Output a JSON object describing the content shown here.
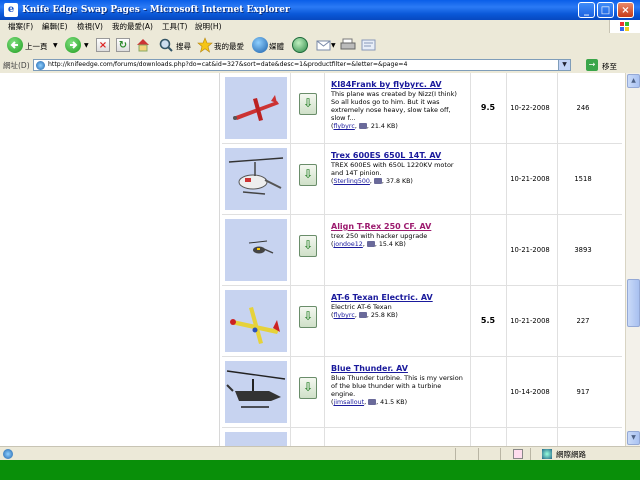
{
  "window": {
    "title": "Knife Edge Swap Pages - Microsoft Internet Explorer"
  },
  "menu": [
    "檔案(F)",
    "編輯(E)",
    "檢視(V)",
    "我的最愛(A)",
    "工具(T)",
    "說明(H)"
  ],
  "toolbar": {
    "back_label": "上一頁",
    "search_label": "搜尋",
    "favorites_label": "我的最愛",
    "media_label": "媒體"
  },
  "address": {
    "label": "網址(D)",
    "url": "http://knifeedge.com/forums/downloads.php?do=cat&id=327&sort=date&desc=1&productfilter=&letter=&page=4",
    "go_label": "移至"
  },
  "rows": [
    {
      "title": "KI84Frank by flybyrc.  AV",
      "desc": "This plane was created by Nizz(I think) So all kudos go to him. But it was extremely nose heavy, slow take off, slow f...",
      "user": "flybyrc",
      "size": "21.4 KB",
      "rating": "9.5",
      "date": "10-22-2008",
      "views": "246",
      "visited": false
    },
    {
      "title": "Trex 600ES 650L 14T.  AV",
      "desc": "TREX 600ES with 650L 1220KV motor and 14T pinion.",
      "user": "Sterling500",
      "size": "37.8 KB",
      "rating": "",
      "date": "10-21-2008",
      "views": "1518",
      "visited": false
    },
    {
      "title": "Align T-Rex 250 CF.  AV",
      "desc": "trex 250 with hacker upgrade",
      "user": "jondoe12",
      "size": "15.4 KB",
      "rating": "",
      "date": "10-21-2008",
      "views": "3893",
      "visited": true
    },
    {
      "title": "AT-6 Texan Electric.  AV",
      "desc": "Electric AT-6 Texan",
      "user": "flybyrc",
      "size": "25.8 KB",
      "rating": "5.5",
      "date": "10-21-2008",
      "views": "227",
      "visited": false
    },
    {
      "title": "Blue Thunder.  AV",
      "desc": "Blue Thunder turbine. This is my version of the blue thunder with a turbine engine.",
      "user": "jimsallout",
      "size": "41.5 KB",
      "rating": "",
      "date": "10-14-2008",
      "views": "917",
      "visited": false
    },
    {
      "title": "",
      "desc": "",
      "user": "",
      "size": "",
      "rating": "",
      "date": "",
      "views": "",
      "visited": false
    }
  ],
  "status": {
    "zone": "網際網路"
  },
  "colors": {
    "titlebar": "#0a5ee8",
    "taskbar": "#098f09",
    "link": "#1a1a9c",
    "visited_link": "#9c1a6e",
    "thumb_bg": "#c7d3f0"
  }
}
